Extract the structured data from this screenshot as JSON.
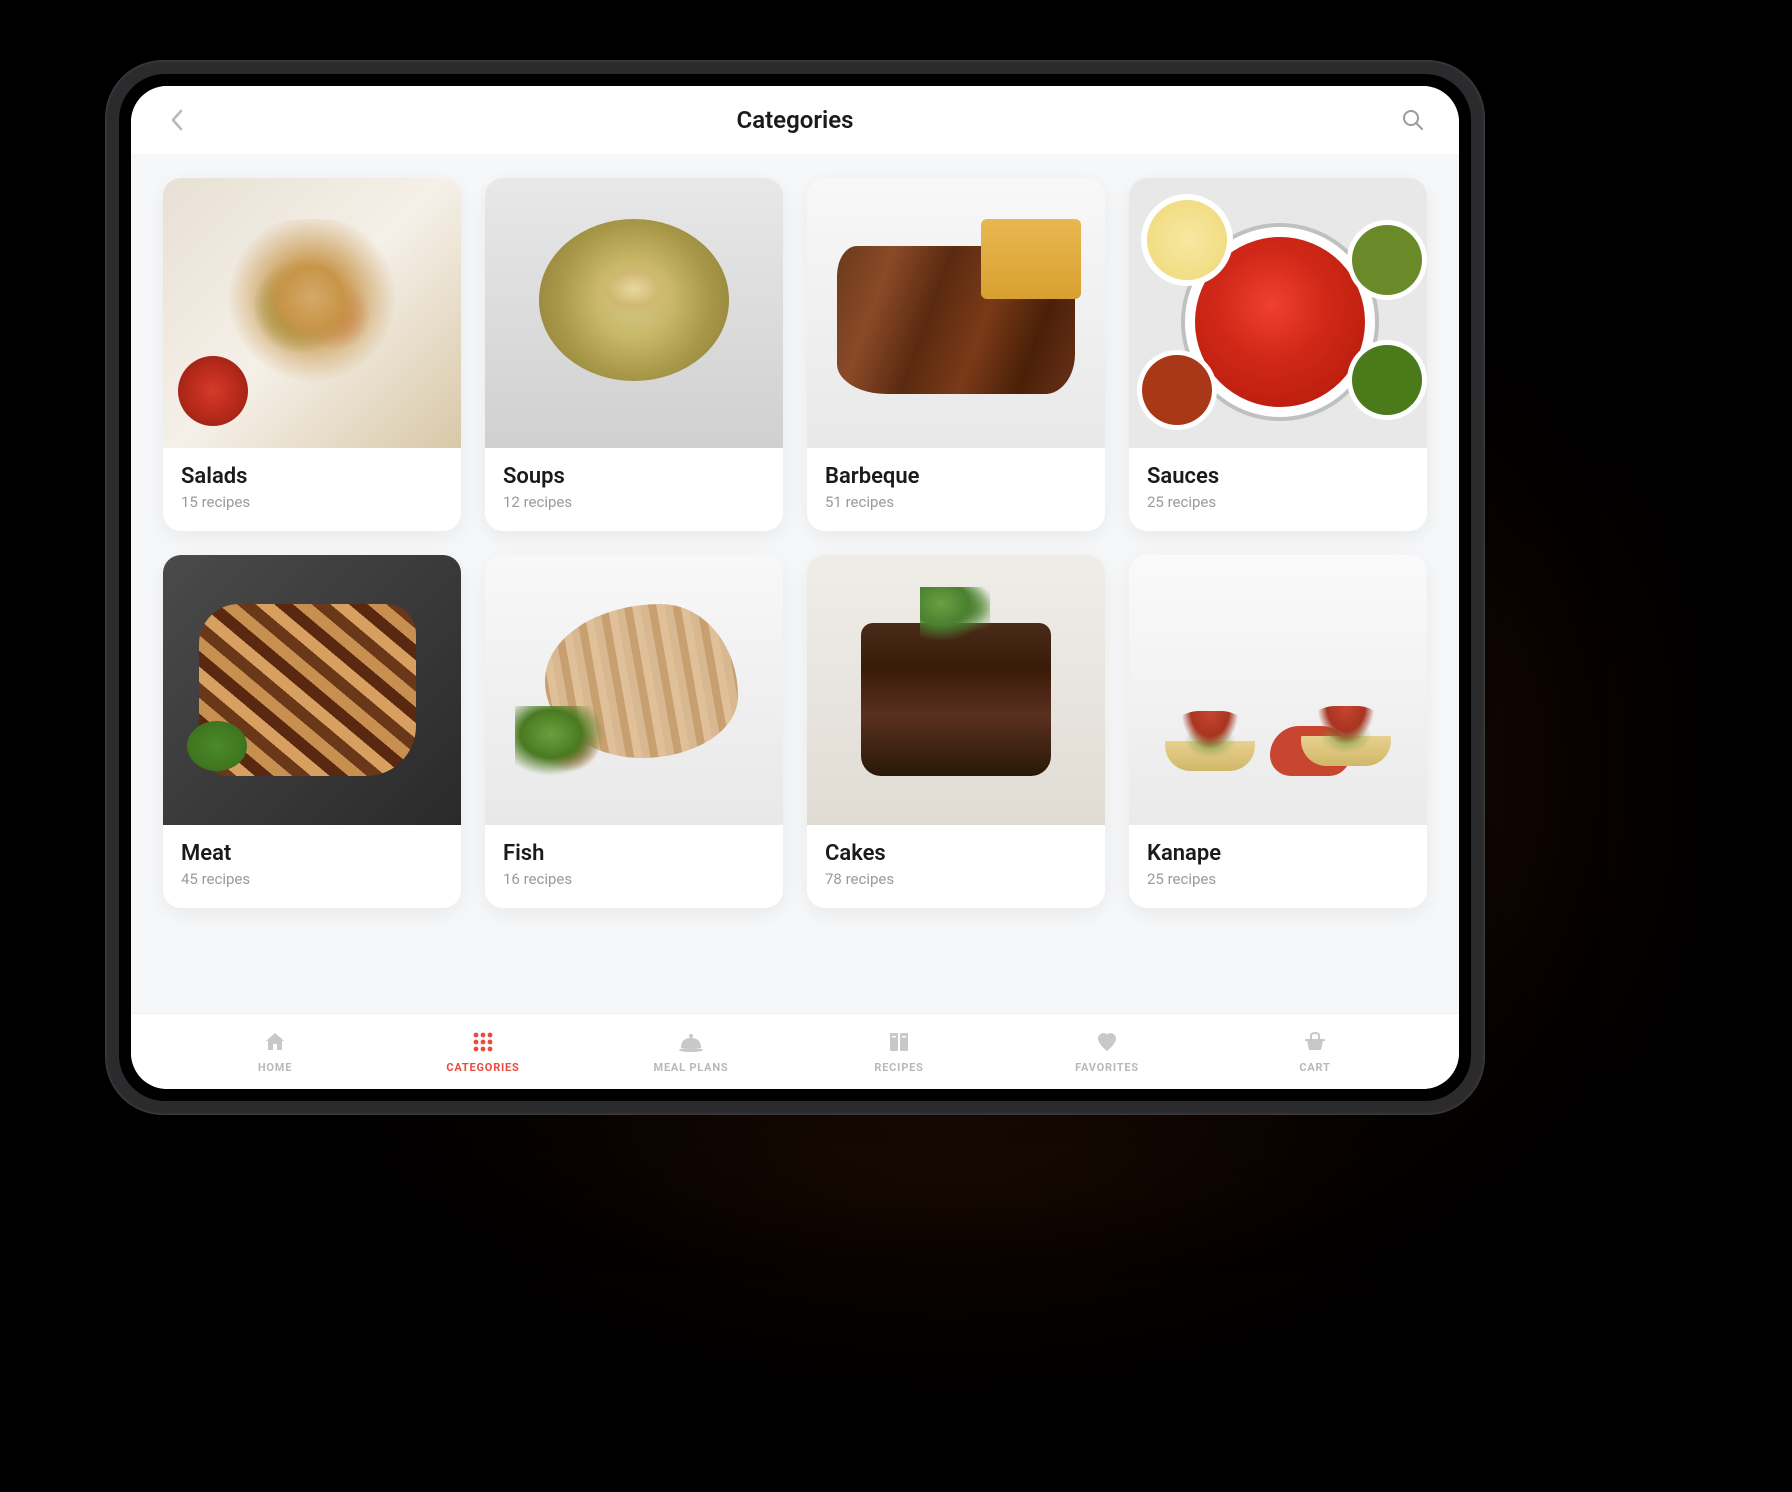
{
  "header": {
    "title": "Categories"
  },
  "colors": {
    "accent": "#e74c3c",
    "muted": "#b8b8b8"
  },
  "categories": [
    {
      "id": "salads",
      "name": "Salads",
      "recipes": 15,
      "sub": "15 recipes"
    },
    {
      "id": "soups",
      "name": "Soups",
      "recipes": 12,
      "sub": "12 recipes"
    },
    {
      "id": "barbeque",
      "name": "Barbeque",
      "recipes": 51,
      "sub": "51 recipes"
    },
    {
      "id": "sauces",
      "name": "Sauces",
      "recipes": 25,
      "sub": "25 recipes"
    },
    {
      "id": "meat",
      "name": "Meat",
      "recipes": 45,
      "sub": "45 recipes"
    },
    {
      "id": "fish",
      "name": "Fish",
      "recipes": 16,
      "sub": "16 recipes"
    },
    {
      "id": "cakes",
      "name": "Cakes",
      "recipes": 78,
      "sub": "78 recipes"
    },
    {
      "id": "kanape",
      "name": "Kanape",
      "recipes": 25,
      "sub": "25 recipes"
    }
  ],
  "tabs": [
    {
      "id": "home",
      "label": "HOME",
      "icon": "home-icon",
      "active": false
    },
    {
      "id": "categories",
      "label": "CATEGORIES",
      "icon": "grid-icon",
      "active": true
    },
    {
      "id": "mealplans",
      "label": "MEAL PLANS",
      "icon": "cloche-icon",
      "active": false
    },
    {
      "id": "recipes",
      "label": "RECIPES",
      "icon": "book-icon",
      "active": false
    },
    {
      "id": "favorites",
      "label": "FAVORITES",
      "icon": "heart-icon",
      "active": false
    },
    {
      "id": "cart",
      "label": "CART",
      "icon": "basket-icon",
      "active": false
    }
  ]
}
